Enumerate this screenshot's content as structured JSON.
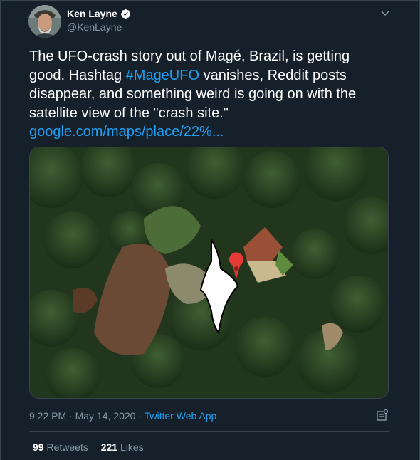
{
  "author": {
    "name": "Ken Layne",
    "handle": "@KenLayne",
    "verified_icon": "verified-badge-icon"
  },
  "tweet": {
    "text_part1": "The UFO-crash story out of Magé, Brazil, is getting good. Hashtag ",
    "hashtag": "#MageUFO",
    "text_part2": " vanishes, Reddit posts disappear, and something weird is going on with the satellite view of the \"crash site.\"",
    "link": "google.com/maps/place/22%..."
  },
  "media": {
    "description_icon": "satellite-map-image"
  },
  "meta": {
    "time": "9:22 PM",
    "separator1": " · ",
    "date": "May 14, 2020",
    "separator2": " · ",
    "source": "Twitter Web App"
  },
  "stats": {
    "retweets_count": "99",
    "retweets_label": "Retweets",
    "likes_count": "221",
    "likes_label": "Likes"
  },
  "colors": {
    "background": "#15202b",
    "accent": "#1da1f2",
    "secondary_text": "#8899a6",
    "border": "#38444d"
  }
}
